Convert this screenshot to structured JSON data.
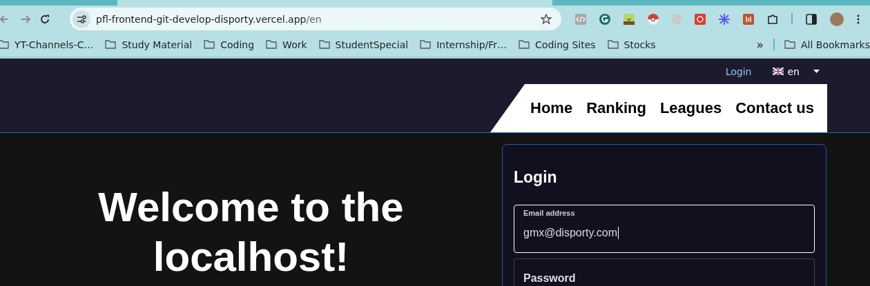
{
  "browser": {
    "url_host": "pfl-frontend-git-develop-disporty.vercel.app",
    "url_path": "/en",
    "bookmarks": [
      "YT-Channels-C…",
      "Study Material",
      "Coding",
      "Work",
      "StudentSpecial",
      "Internship/Fr…",
      "Coding Sites",
      "Stocks"
    ],
    "more": "»",
    "all_bookmarks": "All Bookmarks",
    "extensions": [
      {
        "kind": "code",
        "color": "#a9a9a9"
      },
      {
        "kind": "g",
        "color": "#15715f"
      },
      {
        "kind": "plant",
        "color": "#b9d66a"
      },
      {
        "kind": "ball",
        "color": "#e23b3b"
      },
      {
        "kind": "shield",
        "color": "#c9c9c9"
      },
      {
        "kind": "sync",
        "color": "#e03a2f"
      },
      {
        "kind": "star",
        "color": "#5b5bf0"
      },
      {
        "kind": "bars",
        "color": "#c5532a"
      }
    ]
  },
  "header": {
    "login": "Login",
    "language": "en",
    "nav": [
      "Home",
      "Ranking",
      "Leagues",
      "Contact us"
    ]
  },
  "hero": {
    "title": "Welcome to the localhost!"
  },
  "login_card": {
    "title": "Login",
    "email": {
      "label": "Email address",
      "value": "gmx@disporty.com"
    },
    "password": {
      "label": "Password"
    }
  }
}
